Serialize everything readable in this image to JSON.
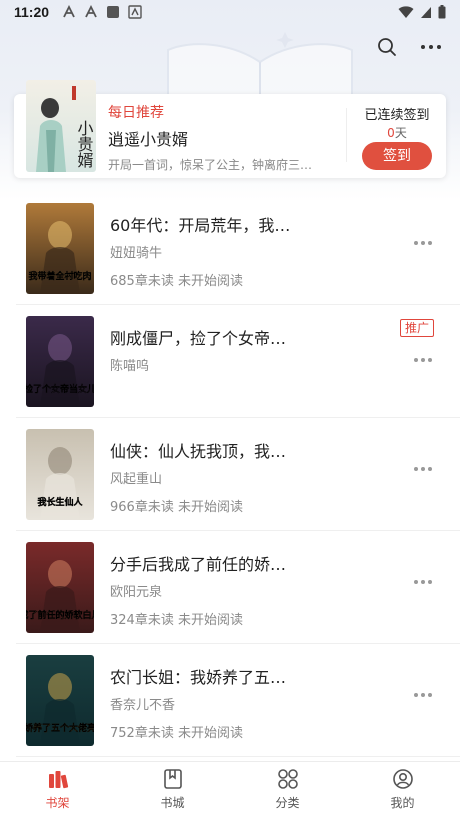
{
  "status_bar": {
    "time": "11:20"
  },
  "daily_recommend": {
    "tag": "每日推荐",
    "title": "逍遥小贵婿",
    "description": "开局一首词，惊呆了公主，钟离府三…",
    "cover_text": "小贵婿",
    "signin_label": "已连续签到",
    "signin_days": "0",
    "signin_unit": "天",
    "signin_button": "签到"
  },
  "books": [
    {
      "title": "60年代：开局荒年，我…",
      "author": "妞妞骑牛",
      "progress": "685章未读 未开始阅读",
      "ad": "",
      "cover_text": "我带着全村吃肉",
      "cover_colors": [
        "#3a2a1a",
        "#b07a3a",
        "#e8c070"
      ]
    },
    {
      "title": "刚成僵尸，捡了个女帝…",
      "author": "陈喵呜",
      "progress": "",
      "ad": "推广",
      "cover_text": "捡了个女帝当女儿",
      "cover_colors": [
        "#1a1420",
        "#3b2a4a",
        "#7a5a8a"
      ]
    },
    {
      "title": "仙侠：仙人抚我顶，我…",
      "author": "风起重山",
      "progress": "966章未读 未开始阅读",
      "ad": "",
      "cover_text": "我长生仙人",
      "cover_colors": [
        "#e8e4dc",
        "#c8c0b0",
        "#8a8070"
      ]
    },
    {
      "title": "分手后我成了前任的娇…",
      "author": "欧阳元泉",
      "progress": "324章未读 未开始阅读",
      "ad": "",
      "cover_text": "我成了前任的娇软白月光",
      "cover_colors": [
        "#3a1a1a",
        "#7a2a2a",
        "#d08060"
      ]
    },
    {
      "title": "农门长姐：我娇养了五…",
      "author": "香奈儿不香",
      "progress": "752章未读 未开始阅读",
      "ad": "",
      "cover_text": "我娇养了五个大佬亮亮",
      "cover_colors": [
        "#0e2a2e",
        "#1a3e40",
        "#c9a24a"
      ]
    }
  ],
  "bottom_nav": [
    {
      "label": "书架",
      "icon": "bookshelf-icon",
      "active": true
    },
    {
      "label": "书城",
      "icon": "bookstore-icon",
      "active": false
    },
    {
      "label": "分类",
      "icon": "category-icon",
      "active": false
    },
    {
      "label": "我的",
      "icon": "profile-icon",
      "active": false
    }
  ],
  "colors": {
    "accent": "#e0463c",
    "signin_button": "#e0503f"
  }
}
